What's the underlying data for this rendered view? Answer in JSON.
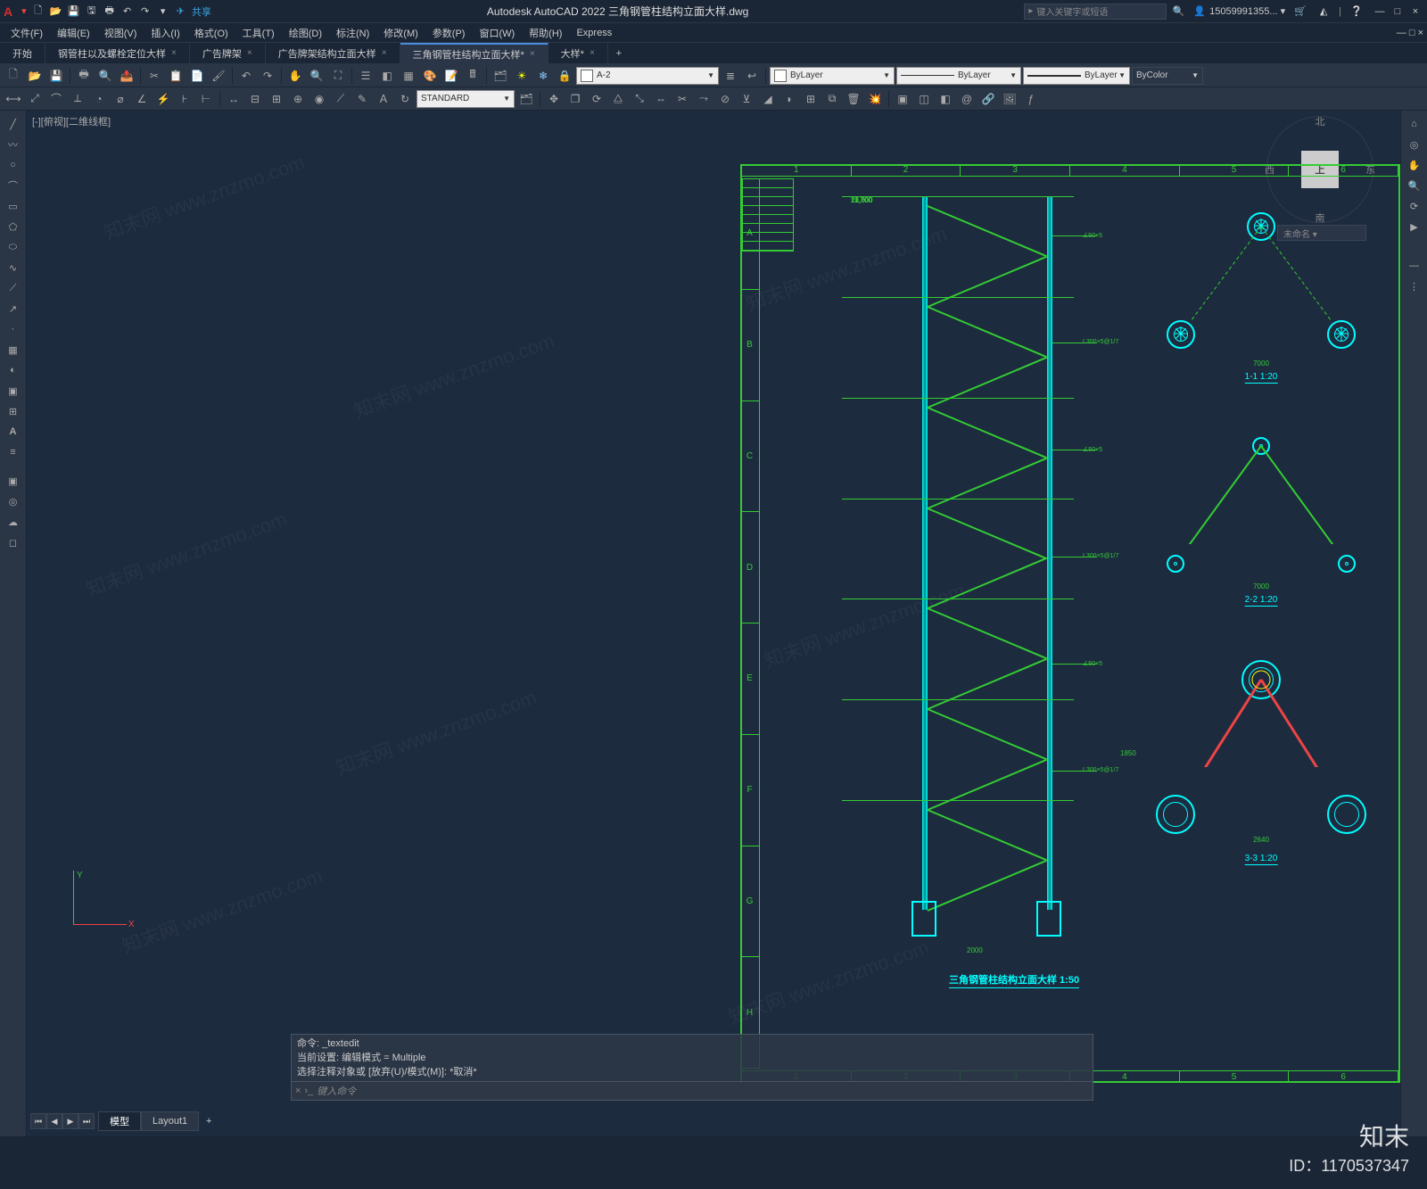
{
  "titlebar": {
    "logo": "A",
    "share_label": "共享",
    "app_title": "Autodesk AutoCAD 2022   三角钢管柱结构立面大样.dwg",
    "search_placeholder": "键入关键字或短语",
    "user_name": "15059991355... ▾",
    "win": {
      "min": "—",
      "max": "□",
      "close": "×"
    },
    "qat_icons": [
      "new",
      "open",
      "save",
      "saveas",
      "plot",
      "undo",
      "redo",
      "sep",
      "share"
    ]
  },
  "menubar": {
    "items": [
      "文件(F)",
      "编辑(E)",
      "视图(V)",
      "插入(I)",
      "格式(O)",
      "工具(T)",
      "绘图(D)",
      "标注(N)",
      "修改(M)",
      "参数(P)",
      "窗口(W)",
      "帮助(H)",
      "Express"
    ]
  },
  "filetabs": {
    "tabs": [
      {
        "label": "开始",
        "closable": false
      },
      {
        "label": "钢管柱以及螺栓定位大样",
        "closable": true
      },
      {
        "label": "广告牌架",
        "closable": true
      },
      {
        "label": "广告牌架结构立面大样",
        "closable": true
      },
      {
        "label": "三角钢管柱结构立面大样*",
        "closable": true,
        "active": true
      },
      {
        "label": "大样*",
        "closable": true
      }
    ]
  },
  "toolbar1": {
    "style_combo": "STANDARD",
    "layer_name": "A-2",
    "layer_dropdown": "ByLayer",
    "linetype": "ByLayer",
    "lineweight": "ByLayer",
    "plotstyle": "ByColor"
  },
  "left_tools": [
    "line",
    "pline",
    "circle",
    "arc",
    "rect",
    "ellipse",
    "hatch",
    "spline",
    "xline",
    "point",
    "region",
    "table",
    "text",
    "mline",
    "sep",
    "move",
    "copy",
    "rotate",
    "mirror",
    "scale",
    "stretch",
    "trim",
    "fillet",
    "array",
    "erase",
    "explode"
  ],
  "right_tools": [
    "home",
    "zoom-all",
    "zoom-window",
    "pan",
    "orbit",
    "steering",
    "showmotion",
    "sep",
    "properties",
    "layers",
    "blocks",
    "sheets",
    "xref",
    "render"
  ],
  "viewport": {
    "label": "[-][俯视][二维线框]"
  },
  "viewcube": {
    "face": "上",
    "n": "北",
    "s": "南",
    "e": "东",
    "w": "西",
    "unnamed": "未命名 ▾"
  },
  "ucs": {
    "x": "X",
    "y": "Y"
  },
  "drawing": {
    "ruler_h": [
      "1",
      "2",
      "3",
      "4",
      "5",
      "6"
    ],
    "ruler_v": [
      "A",
      "B",
      "C",
      "D",
      "E",
      "F",
      "G",
      "H"
    ],
    "main_title": "三角钢管柱结构立面大样 1:50",
    "sec1_title": "1-1 1:20",
    "sec2_title": "2-2 1:20",
    "sec3_title": "3-3 1:20",
    "elev_dims": [
      "21,000",
      "13,800",
      "11,700",
      "±0,000"
    ],
    "base_dim": "2000",
    "leader_labels": [
      "∠50×5",
      "L300×5@1/7",
      "∠50×5",
      "L300×5@1/7",
      "∠50×5",
      "L300×5@1/7"
    ],
    "sec_dims": {
      "s1": "7000",
      "s2": "7000",
      "s3_w": "2640",
      "s3_h": "1850"
    }
  },
  "cmd": {
    "history": [
      "命令: _textedit",
      "当前设置: 编辑模式 = Multiple",
      "选择注释对象或 [放弃(U)/模式(M)]: *取消*"
    ],
    "prompt": "键入命令"
  },
  "model_tabs": {
    "tabs": [
      "模型",
      "Layout1"
    ]
  },
  "watermark": {
    "text": "知末网 www.znzmo.com",
    "logo": "知末",
    "id": "ID：1170537347"
  }
}
